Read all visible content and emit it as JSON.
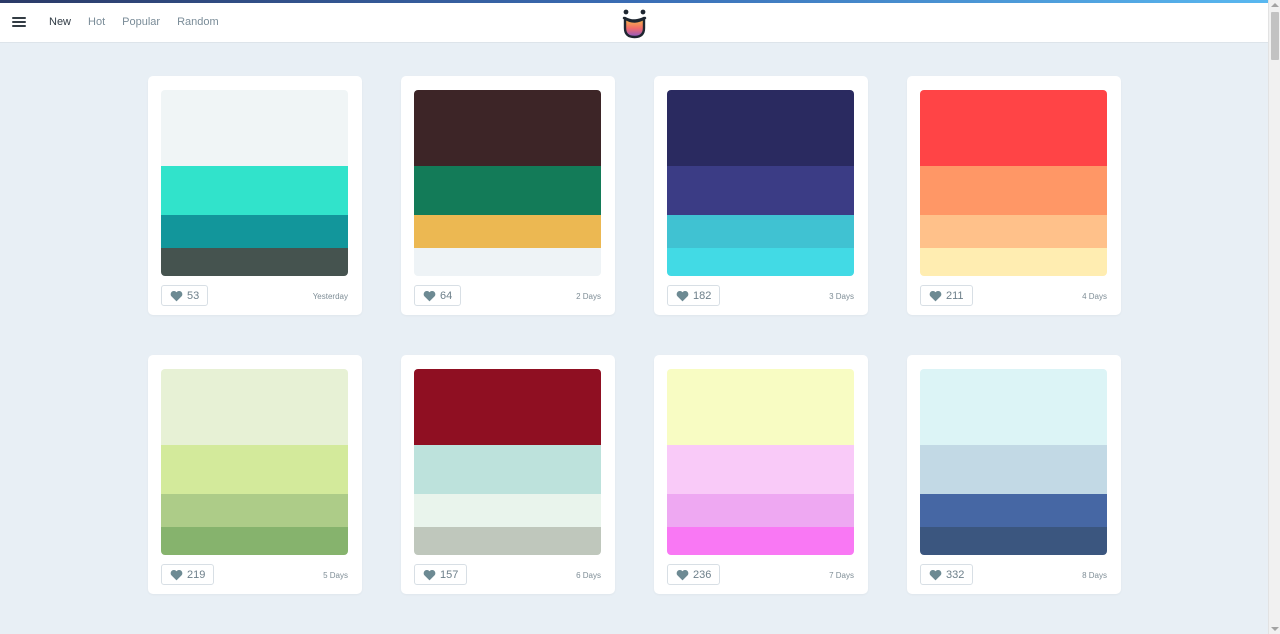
{
  "nav": {
    "items": [
      {
        "label": "New",
        "active": true
      },
      {
        "label": "Hot",
        "active": false
      },
      {
        "label": "Popular",
        "active": false
      },
      {
        "label": "Random",
        "active": false
      }
    ]
  },
  "icons": {
    "menu": "hamburger-menu-icon",
    "logo": "smiling-face-logo-icon",
    "like": "heart-icon"
  },
  "colors": {
    "background": "#e8eff5",
    "accent_start": "#2b3a67",
    "accent_end": "#59b8f0",
    "heart": "#6d8a93"
  },
  "palettes": [
    {
      "colors": [
        "#f0f5f6",
        "#31e3cb",
        "#12969b",
        "#45534f"
      ],
      "likes": "53",
      "date": "Yesterday"
    },
    {
      "colors": [
        "#3d2527",
        "#137b58",
        "#ecb852",
        "#eef3f6"
      ],
      "likes": "64",
      "date": "2 Days"
    },
    {
      "colors": [
        "#2a2a60",
        "#3b3c85",
        "#40c2d2",
        "#42dae5"
      ],
      "likes": "182",
      "date": "3 Days"
    },
    {
      "colors": [
        "#ff4446",
        "#ff9766",
        "#ffc18a",
        "#ffedb1"
      ],
      "likes": "211",
      "date": "4 Days"
    },
    {
      "colors": [
        "#e7f1d5",
        "#d3ea9b",
        "#adcc88",
        "#86b36d"
      ],
      "likes": "219",
      "date": "5 Days"
    },
    {
      "colors": [
        "#8f0f22",
        "#bde2dc",
        "#e9f4ec",
        "#bfc7bc"
      ],
      "likes": "157",
      "date": "6 Days"
    },
    {
      "colors": [
        "#f8fcc3",
        "#f9caf8",
        "#eea8f2",
        "#f978f4"
      ],
      "likes": "236",
      "date": "7 Days"
    },
    {
      "colors": [
        "#dcf4f6",
        "#c2d9e5",
        "#4667a4",
        "#3b567f"
      ],
      "likes": "332",
      "date": "8 Days"
    }
  ]
}
